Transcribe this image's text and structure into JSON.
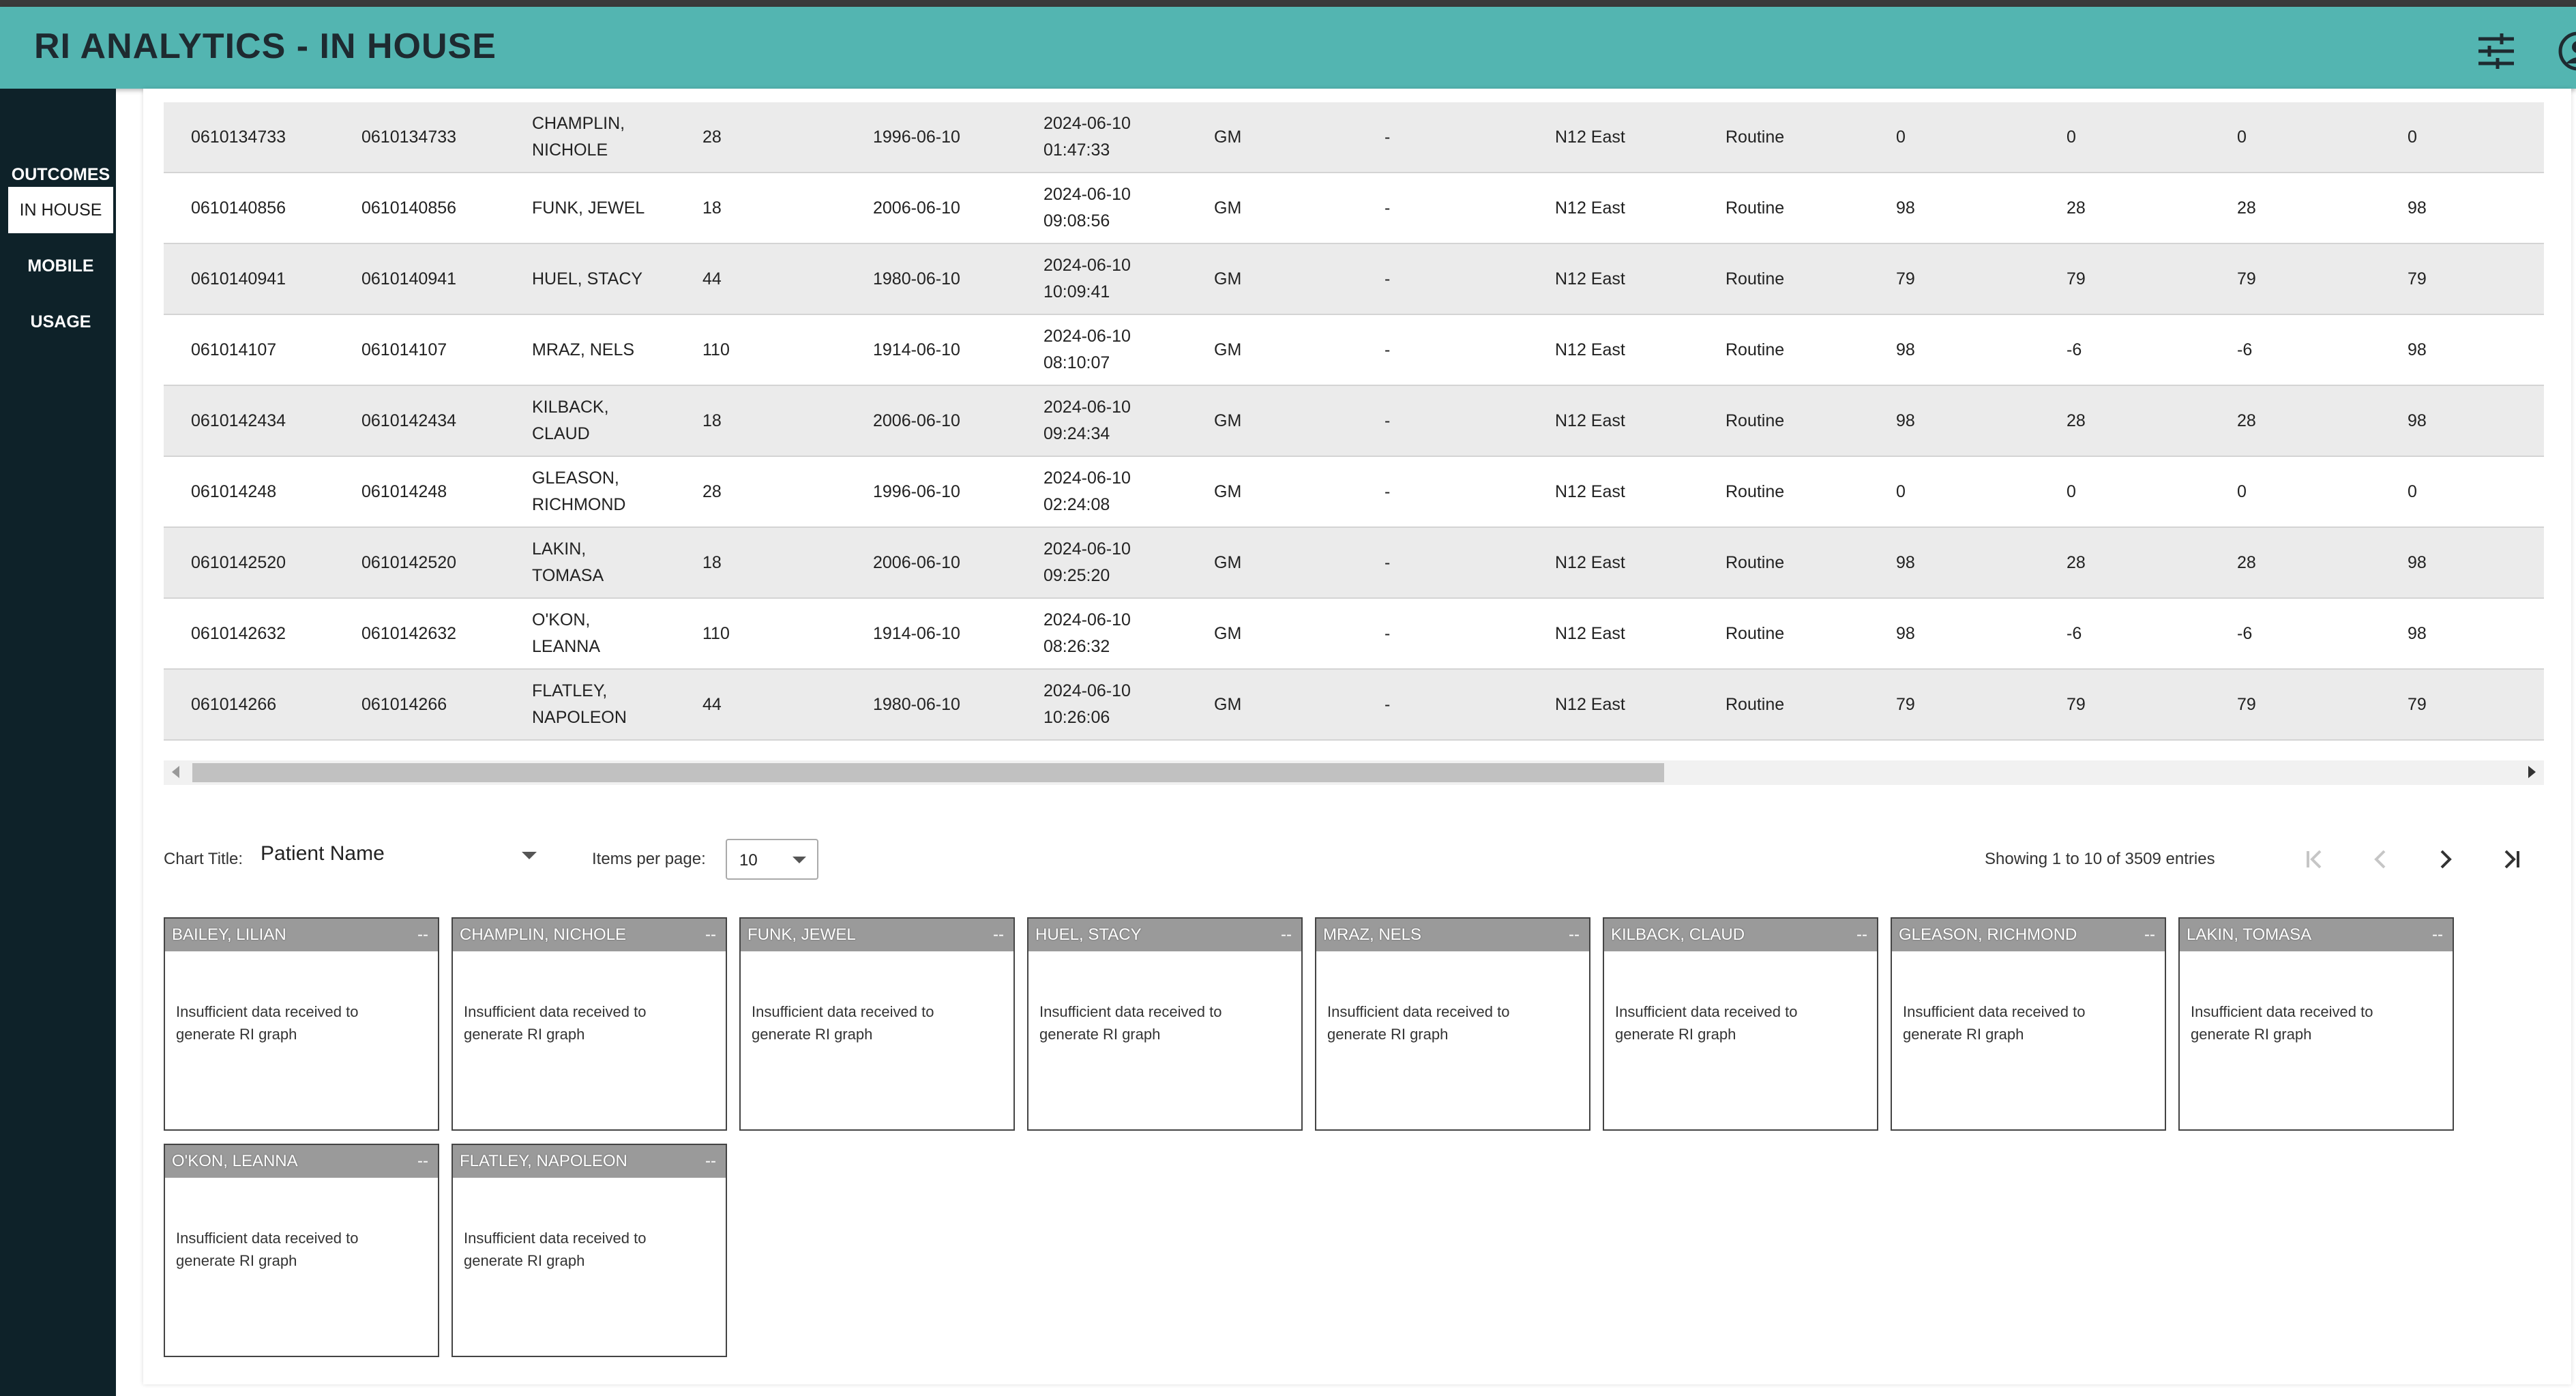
{
  "app": {
    "title": "RI ANALYTICS - IN HOUSE"
  },
  "header_icons": [
    "filter-sliders-icon",
    "user-profile-icon"
  ],
  "colors": {
    "header": "#53b5b1",
    "sidebar": "#0e2229",
    "row_alt": "#ebebeb",
    "card_header": "#9a9a9a"
  },
  "sidebar": {
    "items": [
      {
        "label": "OUTCOMES",
        "active": false
      },
      {
        "label": "IN HOUSE",
        "active": true
      },
      {
        "label": "MOBILE",
        "active": false
      },
      {
        "label": "USAGE",
        "active": false
      }
    ]
  },
  "table": {
    "rows": [
      [
        "0610134733",
        "0610134733",
        "CHAMPLIN,\nNICHOLE",
        "28",
        "1996-06-10",
        "2024-06-10\n01:47:33",
        "GM",
        "-",
        "N12 East",
        "Routine",
        "0",
        "0",
        "0",
        "0"
      ],
      [
        "0610140856",
        "0610140856",
        "FUNK, JEWEL",
        "18",
        "2006-06-10",
        "2024-06-10\n09:08:56",
        "GM",
        "-",
        "N12 East",
        "Routine",
        "98",
        "28",
        "28",
        "98"
      ],
      [
        "0610140941",
        "0610140941",
        "HUEL, STACY",
        "44",
        "1980-06-10",
        "2024-06-10\n10:09:41",
        "GM",
        "-",
        "N12 East",
        "Routine",
        "79",
        "79",
        "79",
        "79"
      ],
      [
        "061014107",
        "061014107",
        "MRAZ, NELS",
        "110",
        "1914-06-10",
        "2024-06-10\n08:10:07",
        "GM",
        "-",
        "N12 East",
        "Routine",
        "98",
        "-6",
        "-6",
        "98"
      ],
      [
        "0610142434",
        "0610142434",
        "KILBACK,\nCLAUD",
        "18",
        "2006-06-10",
        "2024-06-10\n09:24:34",
        "GM",
        "-",
        "N12 East",
        "Routine",
        "98",
        "28",
        "28",
        "98"
      ],
      [
        "061014248",
        "061014248",
        "GLEASON,\nRICHMOND",
        "28",
        "1996-06-10",
        "2024-06-10\n02:24:08",
        "GM",
        "-",
        "N12 East",
        "Routine",
        "0",
        "0",
        "0",
        "0"
      ],
      [
        "0610142520",
        "0610142520",
        "LAKIN,\nTOMASA",
        "18",
        "2006-06-10",
        "2024-06-10\n09:25:20",
        "GM",
        "-",
        "N12 East",
        "Routine",
        "98",
        "28",
        "28",
        "98"
      ],
      [
        "0610142632",
        "0610142632",
        "O'KON,\nLEANNA",
        "110",
        "1914-06-10",
        "2024-06-10\n08:26:32",
        "GM",
        "-",
        "N12 East",
        "Routine",
        "98",
        "-6",
        "-6",
        "98"
      ],
      [
        "061014266",
        "061014266",
        "FLATLEY,\nNAPOLEON",
        "44",
        "1980-06-10",
        "2024-06-10\n10:26:06",
        "GM",
        "-",
        "N12 East",
        "Routine",
        "79",
        "79",
        "79",
        "79"
      ]
    ]
  },
  "controls": {
    "chart_title_label": "Chart Title:",
    "chart_title_value": "Patient Name",
    "items_per_page_label": "Items per page:",
    "items_per_page_value": "10",
    "showing": "Showing 1 to 10 of 3509 entries",
    "pager_icons": [
      "first-page-icon",
      "prev-page-icon",
      "next-page-icon",
      "last-page-icon"
    ]
  },
  "cards": {
    "message": "Insufficient data received to generate RI graph",
    "items": [
      {
        "name": "BAILEY, LILIAN",
        "value": "--"
      },
      {
        "name": "CHAMPLIN, NICHOLE",
        "value": "--"
      },
      {
        "name": "FUNK, JEWEL",
        "value": "--"
      },
      {
        "name": "HUEL, STACY",
        "value": "--"
      },
      {
        "name": "MRAZ, NELS",
        "value": "--"
      },
      {
        "name": "KILBACK, CLAUD",
        "value": "--"
      },
      {
        "name": "GLEASON, RICHMOND",
        "value": "--"
      },
      {
        "name": "LAKIN, TOMASA",
        "value": "--"
      },
      {
        "name": "O'KON, LEANNA",
        "value": "--"
      },
      {
        "name": "FLATLEY, NAPOLEON",
        "value": "--"
      }
    ]
  }
}
